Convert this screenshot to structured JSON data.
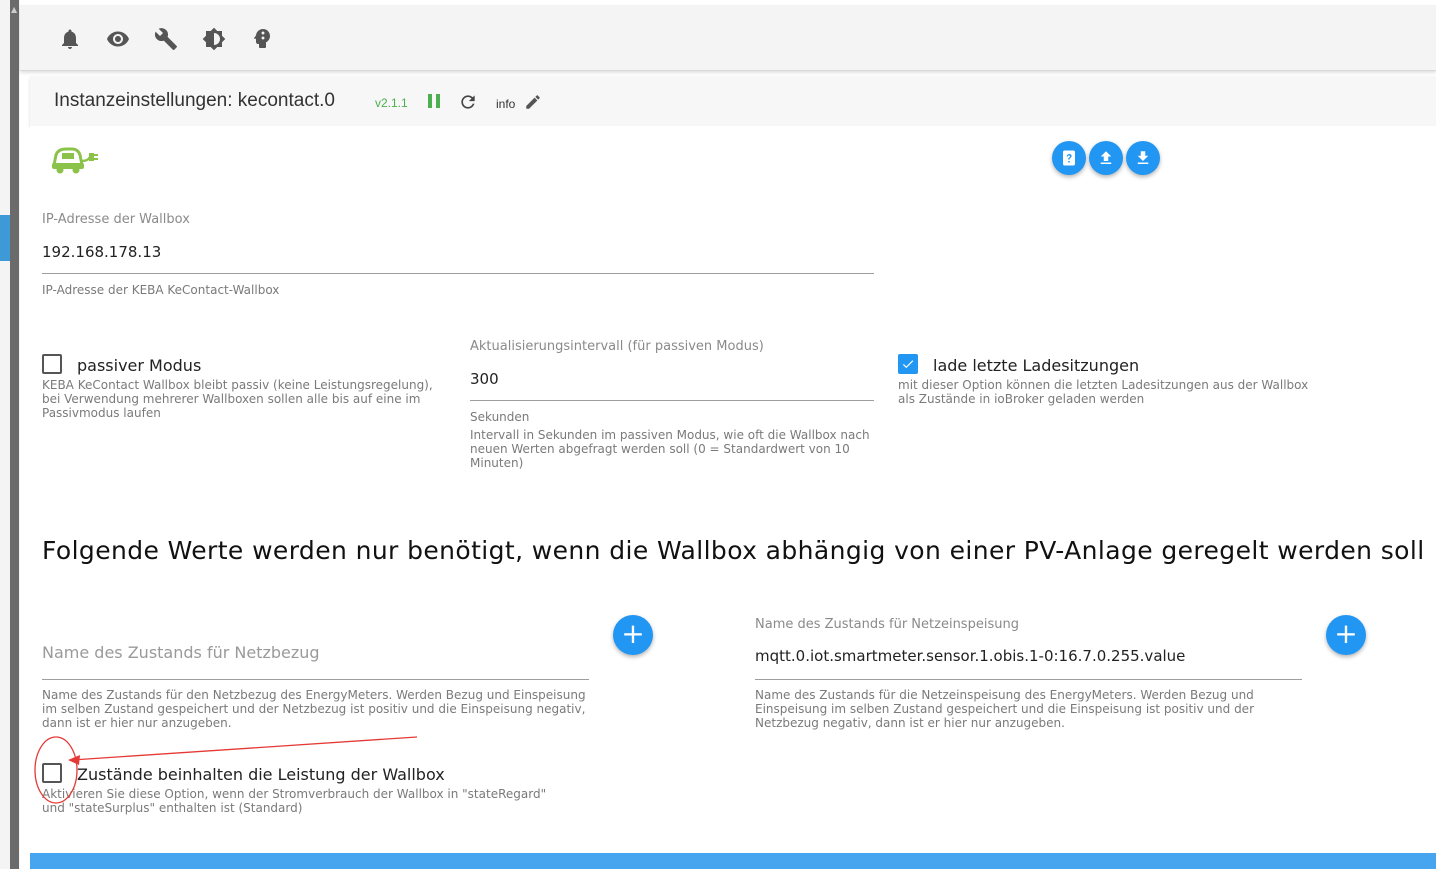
{
  "toolbar": {
    "icons": [
      "bell-icon",
      "eye-icon",
      "wrench-icon",
      "brightness-icon",
      "head-icon"
    ]
  },
  "header": {
    "title": "Instanzeinstellungen: kecontact.0",
    "version": "v2.1.1",
    "info_label": "info"
  },
  "colors": {
    "accent": "#2196f3",
    "running_green": "#4caf50",
    "logo_green": "#8bc34a",
    "annotation_red": "#e53935"
  },
  "ip_field": {
    "label": "IP-Adresse der Wallbox",
    "value": "192.168.178.13",
    "helper": "IP-Adresse der KEBA KeContact-Wallbox"
  },
  "passive_mode": {
    "label": "passiver Modus",
    "checked": false,
    "helper": "KEBA KeContact Wallbox bleibt passiv (keine Leistungsregelung), bei Verwendung mehrerer Wallboxen sollen alle bis auf eine im Passivmodus laufen"
  },
  "interval_field": {
    "label": "Aktualisierungsintervall (für passiven Modus)",
    "value": "300",
    "unit": "Sekunden",
    "helper": "Intervall in Sekunden im passiven Modus, wie oft die Wallbox nach neuen Werten abgefragt werden soll (0 = Standardwert von 10 Minuten)"
  },
  "load_sessions": {
    "label": "lade letzte Ladesitzungen",
    "checked": true,
    "helper": "mit dieser Option können die letzten Ladesitzungen aus der Wallbox als Zustände in ioBroker geladen werden"
  },
  "section_heading": "Folgende Werte werden nur benötigt, wenn die Wallbox abhängig von einer PV-Anlage geregelt werden soll",
  "state_regard": {
    "placeholder": "Name des Zustands für Netzbezug",
    "helper": "Name des Zustands für den Netzbezug des EnergyMeters. Werden Bezug und Einspeisung im selben Zustand gespeichert und der Netzbezug ist positiv und die Einspeisung negativ, dann ist er hier nur anzugeben.",
    "add_button": "+"
  },
  "state_surplus": {
    "label": "Name des Zustands für Netzeinspeisung",
    "value": "mqtt.0.iot.smartmeter.sensor.1.obis.1-0:16.7.0.255.value",
    "helper": "Name des Zustands für die Netzeinspeisung des EnergyMeters. Werden Bezug und Einspeisung im selben Zustand gespeichert und die Einspeisung ist positiv und der Netzbezug negativ, dann ist er hier nur anzugeben.",
    "add_button": "+"
  },
  "states_include_wallbox": {
    "label": "Zustände beinhalten die Leistung der Wallbox",
    "checked": false,
    "helper": "Aktivieren Sie diese Option, wenn der Stromverbrauch der Wallbox in \"stateRegard\" und \"stateSurplus\" enthalten ist (Standard)"
  }
}
